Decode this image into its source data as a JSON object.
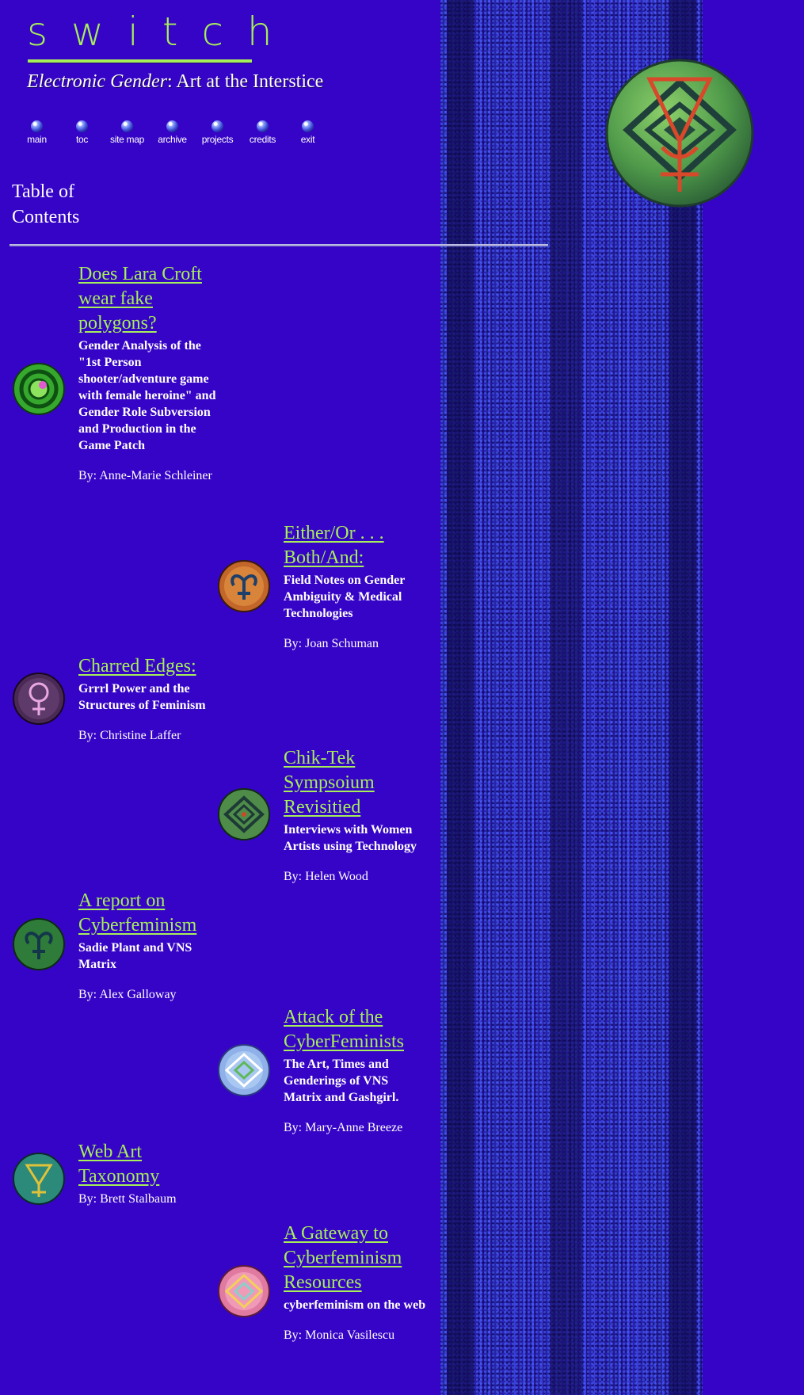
{
  "header": {
    "logo": "switch",
    "subtitle_italic": "Electronic Gender",
    "subtitle_rest": ": Art at the Interstice"
  },
  "nav": [
    "main",
    "toc",
    "site map",
    "archive",
    "projects",
    "credits",
    "exit"
  ],
  "page_title": "Table of Contents",
  "entries": [
    {
      "title": "Does Lara Croft wear fake polygons?",
      "description": "Gender Analysis of the \"1st Person shooter/adventure game with female heroine\" and Gender Role Subversion and Production in the Game Patch",
      "author": "By: Anne-Marie Schleiner",
      "icon": "green-swirl-icon"
    },
    {
      "title": "Either/Or . . . Both/And:",
      "description": "Field Notes on Gender Ambiguity & Medical Technologies",
      "author": "By: Joan Schuman",
      "icon": "copper-ram-icon"
    },
    {
      "title": "Charred Edges:",
      "description": "Grrrl Power and the Structures of Feminism",
      "author": "By: Christine Laffer",
      "icon": "venus-symbol-icon"
    },
    {
      "title": "Chik-Tek Sympsoium Revisitied",
      "description": "Interviews with Women Artists using Technology",
      "author": "By: Helen Wood",
      "icon": "green-diamond-icon"
    },
    {
      "title": "A report on Cyberfeminism",
      "description": "Sadie Plant and VNS Matrix",
      "author": "By: Alex Galloway",
      "icon": "green-ram-icon"
    },
    {
      "title": "Attack of the CyberFeminists",
      "description": "The Art, Times and Genderings of VNS Matrix and Gashgirl.",
      "author": "By: Mary-Anne Breeze",
      "icon": "light-blue-diamond-icon"
    },
    {
      "title": "Web Art Taxonomy",
      "description": "",
      "author": "By: Brett Stalbaum",
      "icon": "teal-glyph-icon"
    },
    {
      "title": "A Gateway to Cyberfeminism Resources",
      "description": "cyberfeminism on the web",
      "author": "By: Monica Vasilescu",
      "icon": "pink-diamond-icon"
    }
  ],
  "colors": {
    "background": "#3604c6",
    "link": "#a6ee5a",
    "text": "#ffffff"
  }
}
